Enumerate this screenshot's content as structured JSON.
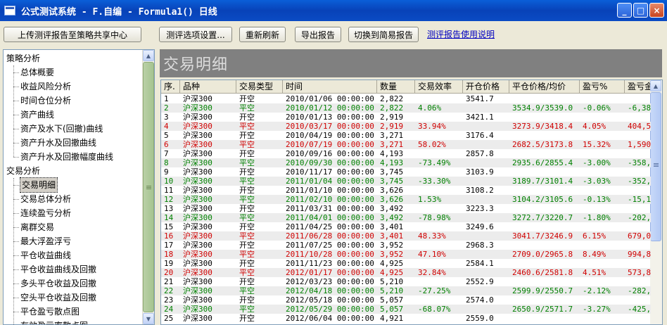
{
  "window": {
    "title": "公式测试系统 - F.自编 - Formula1() 日线",
    "minimize": "_",
    "maximize": "□",
    "close": "×"
  },
  "toolbar": {
    "upload": "上传测评报告至策略共享中心",
    "settings": "测评选项设置...",
    "refresh": "重新刷新",
    "export": "导出报告",
    "switch_simple": "切换到简易报告",
    "help_link": "测评报告使用说明"
  },
  "tree": {
    "groups": [
      {
        "label": "策略分析",
        "items": [
          "总体概要",
          "收益风险分析",
          "时间仓位分析",
          "资产曲线",
          "资产及水下(回撤)曲线",
          "资产升水及回撤曲线",
          "资产升水及回撤幅度曲线"
        ]
      },
      {
        "label": "交易分析",
        "items": [
          "交易明细",
          "交易总体分析",
          "连续盈亏分析",
          "离群交易",
          "最大浮盈浮亏",
          "平仓收益曲线",
          "平仓收益曲线及回撤",
          "多头平仓收益及回撤",
          "空头平仓收益及回撤",
          "平仓盈亏散点图",
          "有效盈亏率散点图"
        ]
      }
    ],
    "selected": "交易明细"
  },
  "panel": {
    "title": "交易明细"
  },
  "table": {
    "columns": [
      "序.",
      "品种",
      "交易类型",
      "时间",
      "数量",
      "交易效率",
      "开仓价格",
      "平仓价格/均价",
      "盈亏%",
      "盈亏金"
    ],
    "rows": [
      {
        "no": "1",
        "sym": "沪深300",
        "type": "开空",
        "time": "2010/01/06 00:00:00",
        "qty": "2,822",
        "eff": "",
        "open": "3541.7",
        "close": "",
        "pct": "",
        "amt": "",
        "color": "black"
      },
      {
        "no": "2",
        "sym": "沪深300",
        "type": "平空",
        "time": "2010/01/12 00:00:00",
        "qty": "2,822",
        "eff": "4.06%",
        "open": "",
        "close": "3534.9/3539.0",
        "pct": "-0.06%",
        "amt": "-6,38",
        "color": "green"
      },
      {
        "no": "3",
        "sym": "沪深300",
        "type": "开空",
        "time": "2010/01/13 00:00:00",
        "qty": "2,919",
        "eff": "",
        "open": "3421.1",
        "close": "",
        "pct": "",
        "amt": "",
        "color": "black"
      },
      {
        "no": "4",
        "sym": "沪深300",
        "type": "平空",
        "time": "2010/03/17 00:00:00",
        "qty": "2,919",
        "eff": "33.94%",
        "open": "",
        "close": "3273.9/3418.4",
        "pct": "4.05%",
        "amt": "404,5",
        "color": "red"
      },
      {
        "no": "5",
        "sym": "沪深300",
        "type": "开空",
        "time": "2010/04/19 00:00:00",
        "qty": "3,271",
        "eff": "",
        "open": "3176.4",
        "close": "",
        "pct": "",
        "amt": "",
        "color": "black"
      },
      {
        "no": "6",
        "sym": "沪深300",
        "type": "平空",
        "time": "2010/07/19 00:00:00",
        "qty": "3,271",
        "eff": "58.02%",
        "open": "",
        "close": "2682.5/3173.8",
        "pct": "15.32%",
        "amt": "1,590",
        "color": "red"
      },
      {
        "no": "7",
        "sym": "沪深300",
        "type": "开空",
        "time": "2010/09/16 00:00:00",
        "qty": "4,193",
        "eff": "",
        "open": "2857.8",
        "close": "",
        "pct": "",
        "amt": "",
        "color": "black"
      },
      {
        "no": "8",
        "sym": "沪深300",
        "type": "平空",
        "time": "2010/09/30 00:00:00",
        "qty": "4,193",
        "eff": "-73.49%",
        "open": "",
        "close": "2935.6/2855.4",
        "pct": "-3.00%",
        "amt": "-358,",
        "color": "green"
      },
      {
        "no": "9",
        "sym": "沪深300",
        "type": "开空",
        "time": "2010/11/17 00:00:00",
        "qty": "3,745",
        "eff": "",
        "open": "3103.9",
        "close": "",
        "pct": "",
        "amt": "",
        "color": "black"
      },
      {
        "no": "10",
        "sym": "沪深300",
        "type": "平空",
        "time": "2011/01/04 00:00:00",
        "qty": "3,745",
        "eff": "-33.30%",
        "open": "",
        "close": "3189.7/3101.4",
        "pct": "-3.03%",
        "amt": "-352,",
        "color": "green"
      },
      {
        "no": "11",
        "sym": "沪深300",
        "type": "开空",
        "time": "2011/01/10 00:00:00",
        "qty": "3,626",
        "eff": "",
        "open": "3108.2",
        "close": "",
        "pct": "",
        "amt": "",
        "color": "black"
      },
      {
        "no": "12",
        "sym": "沪深300",
        "type": "平空",
        "time": "2011/02/10 00:00:00",
        "qty": "3,626",
        "eff": "1.53%",
        "open": "",
        "close": "3104.2/3105.6",
        "pct": "-0.13%",
        "amt": "-15,1",
        "color": "green"
      },
      {
        "no": "13",
        "sym": "沪深300",
        "type": "开空",
        "time": "2011/03/31 00:00:00",
        "qty": "3,492",
        "eff": "",
        "open": "3223.3",
        "close": "",
        "pct": "",
        "amt": "",
        "color": "black"
      },
      {
        "no": "14",
        "sym": "沪深300",
        "type": "平空",
        "time": "2011/04/01 00:00:00",
        "qty": "3,492",
        "eff": "-78.98%",
        "open": "",
        "close": "3272.7/3220.7",
        "pct": "-1.80%",
        "amt": "-202,",
        "color": "green"
      },
      {
        "no": "15",
        "sym": "沪深300",
        "type": "开空",
        "time": "2011/04/25 00:00:00",
        "qty": "3,401",
        "eff": "",
        "open": "3249.6",
        "close": "",
        "pct": "",
        "amt": "",
        "color": "black"
      },
      {
        "no": "16",
        "sym": "沪深300",
        "type": "平空",
        "time": "2011/06/28 00:00:00",
        "qty": "3,401",
        "eff": "48.33%",
        "open": "",
        "close": "3041.7/3246.9",
        "pct": "6.15%",
        "amt": "679,0",
        "color": "red"
      },
      {
        "no": "17",
        "sym": "沪深300",
        "type": "开空",
        "time": "2011/07/25 00:00:00",
        "qty": "3,952",
        "eff": "",
        "open": "2968.3",
        "close": "",
        "pct": "",
        "amt": "",
        "color": "black"
      },
      {
        "no": "18",
        "sym": "沪深300",
        "type": "平空",
        "time": "2011/10/28 00:00:00",
        "qty": "3,952",
        "eff": "47.10%",
        "open": "",
        "close": "2709.0/2965.8",
        "pct": "8.49%",
        "amt": "994,8",
        "color": "red"
      },
      {
        "no": "19",
        "sym": "沪深300",
        "type": "开空",
        "time": "2011/11/23 00:00:00",
        "qty": "4,925",
        "eff": "",
        "open": "2584.1",
        "close": "",
        "pct": "",
        "amt": "",
        "color": "black"
      },
      {
        "no": "20",
        "sym": "沪深300",
        "type": "平空",
        "time": "2012/01/17 00:00:00",
        "qty": "4,925",
        "eff": "32.84%",
        "open": "",
        "close": "2460.6/2581.8",
        "pct": "4.51%",
        "amt": "573,8",
        "color": "red"
      },
      {
        "no": "21",
        "sym": "沪深300",
        "type": "开空",
        "time": "2012/03/23 00:00:00",
        "qty": "5,210",
        "eff": "",
        "open": "2552.9",
        "close": "",
        "pct": "",
        "amt": "",
        "color": "black"
      },
      {
        "no": "22",
        "sym": "沪深300",
        "type": "平空",
        "time": "2012/04/18 00:00:00",
        "qty": "5,210",
        "eff": "-27.25%",
        "open": "",
        "close": "2599.9/2550.7",
        "pct": "-2.12%",
        "amt": "-282,",
        "color": "green"
      },
      {
        "no": "23",
        "sym": "沪深300",
        "type": "开空",
        "time": "2012/05/18 00:00:00",
        "qty": "5,057",
        "eff": "",
        "open": "2574.0",
        "close": "",
        "pct": "",
        "amt": "",
        "color": "black"
      },
      {
        "no": "24",
        "sym": "沪深300",
        "type": "平空",
        "time": "2012/05/29 00:00:00",
        "qty": "5,057",
        "eff": "-68.07%",
        "open": "",
        "close": "2650.9/2571.7",
        "pct": "-3.27%",
        "amt": "-425,",
        "color": "green"
      },
      {
        "no": "25",
        "sym": "沪深300",
        "type": "开空",
        "time": "2012/06/04 00:00:00",
        "qty": "4,921",
        "eff": "",
        "open": "2559.0",
        "close": "",
        "pct": "",
        "amt": "",
        "color": "black"
      }
    ]
  }
}
